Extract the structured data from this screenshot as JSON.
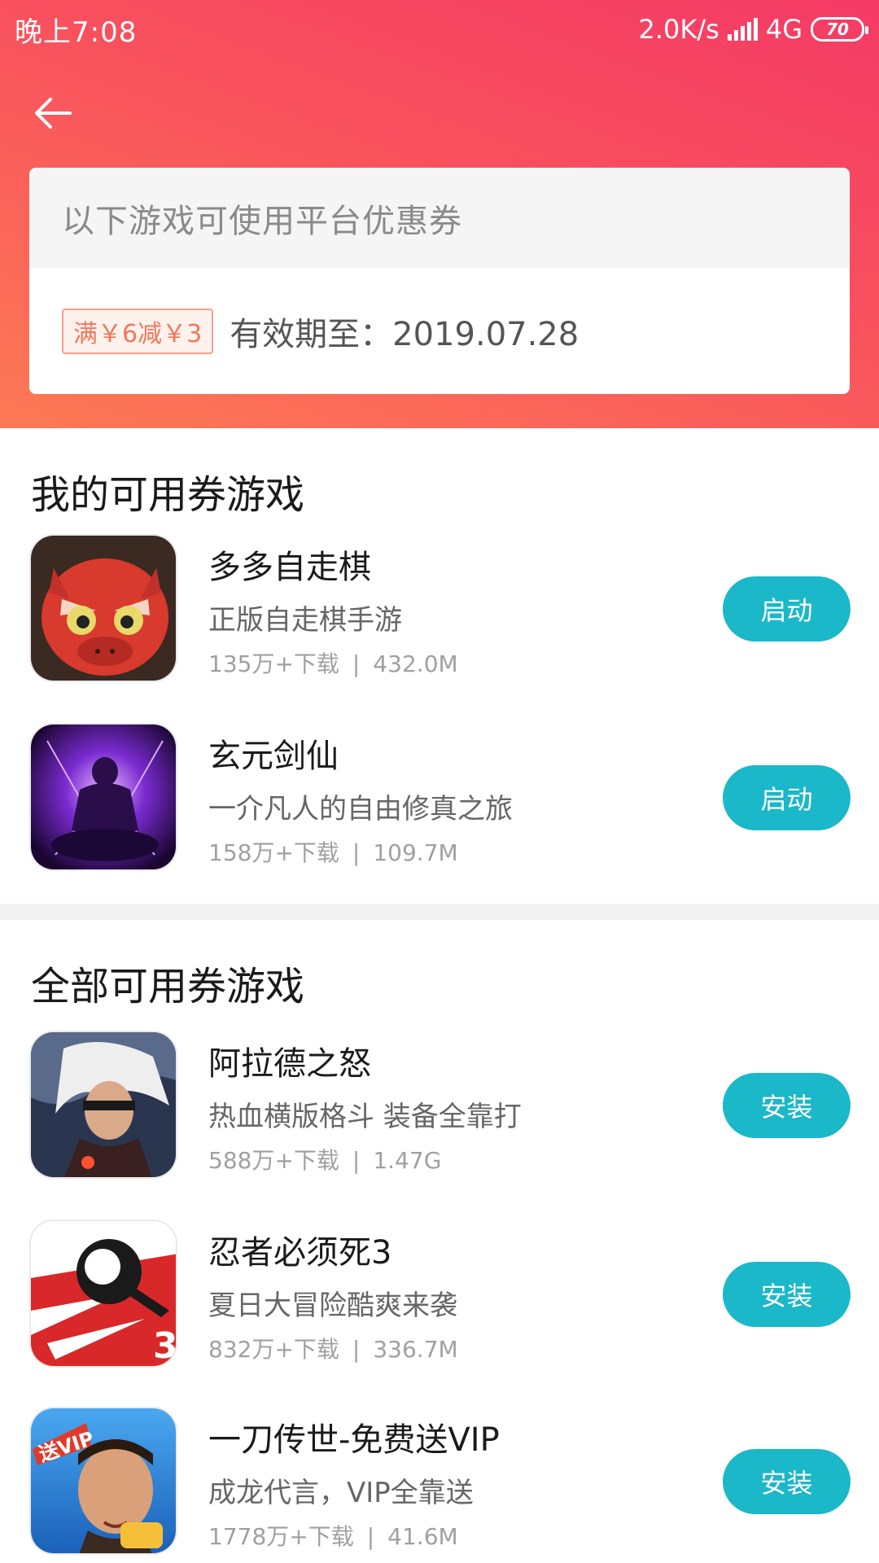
{
  "status_bar": {
    "time": "晚上7:08",
    "speed": "2.0K/s",
    "network": "4G",
    "battery": "70"
  },
  "coupon": {
    "header": "以下游戏可使用平台优惠券",
    "tag": "满￥6减￥3",
    "validity": "有效期至：2019.07.28"
  },
  "my_games": {
    "title": "我的可用券游戏",
    "items": [
      {
        "name": "多多自走棋",
        "desc": "正版自走棋手游",
        "downloads": "135万+下载",
        "size": "432.0M",
        "action": "启动"
      },
      {
        "name": "玄元剑仙",
        "desc": "一介凡人的自由修真之旅",
        "downloads": "158万+下载",
        "size": "109.7M",
        "action": "启动"
      }
    ]
  },
  "all_games": {
    "title": "全部可用券游戏",
    "items": [
      {
        "name": "阿拉德之怒",
        "desc": "热血横版格斗 装备全靠打",
        "downloads": "588万+下载",
        "size": "1.47G",
        "action": "安装"
      },
      {
        "name": "忍者必须死3",
        "desc": "夏日大冒险酷爽来袭",
        "downloads": "832万+下载",
        "size": "336.7M",
        "action": "安装"
      },
      {
        "name": "一刀传世-免费送VIP",
        "desc": "成龙代言，VIP全靠送",
        "downloads": "1778万+下载",
        "size": "41.6M",
        "action": "安装"
      }
    ]
  },
  "icon_art": {
    "ninja_badge": "3",
    "vip_badge": "送VIP"
  },
  "colors": {
    "accent": "#1ab8c8",
    "hero_start": "#f43a66",
    "hero_end": "#fd7a55",
    "coupon_tag": "#f2765a"
  }
}
